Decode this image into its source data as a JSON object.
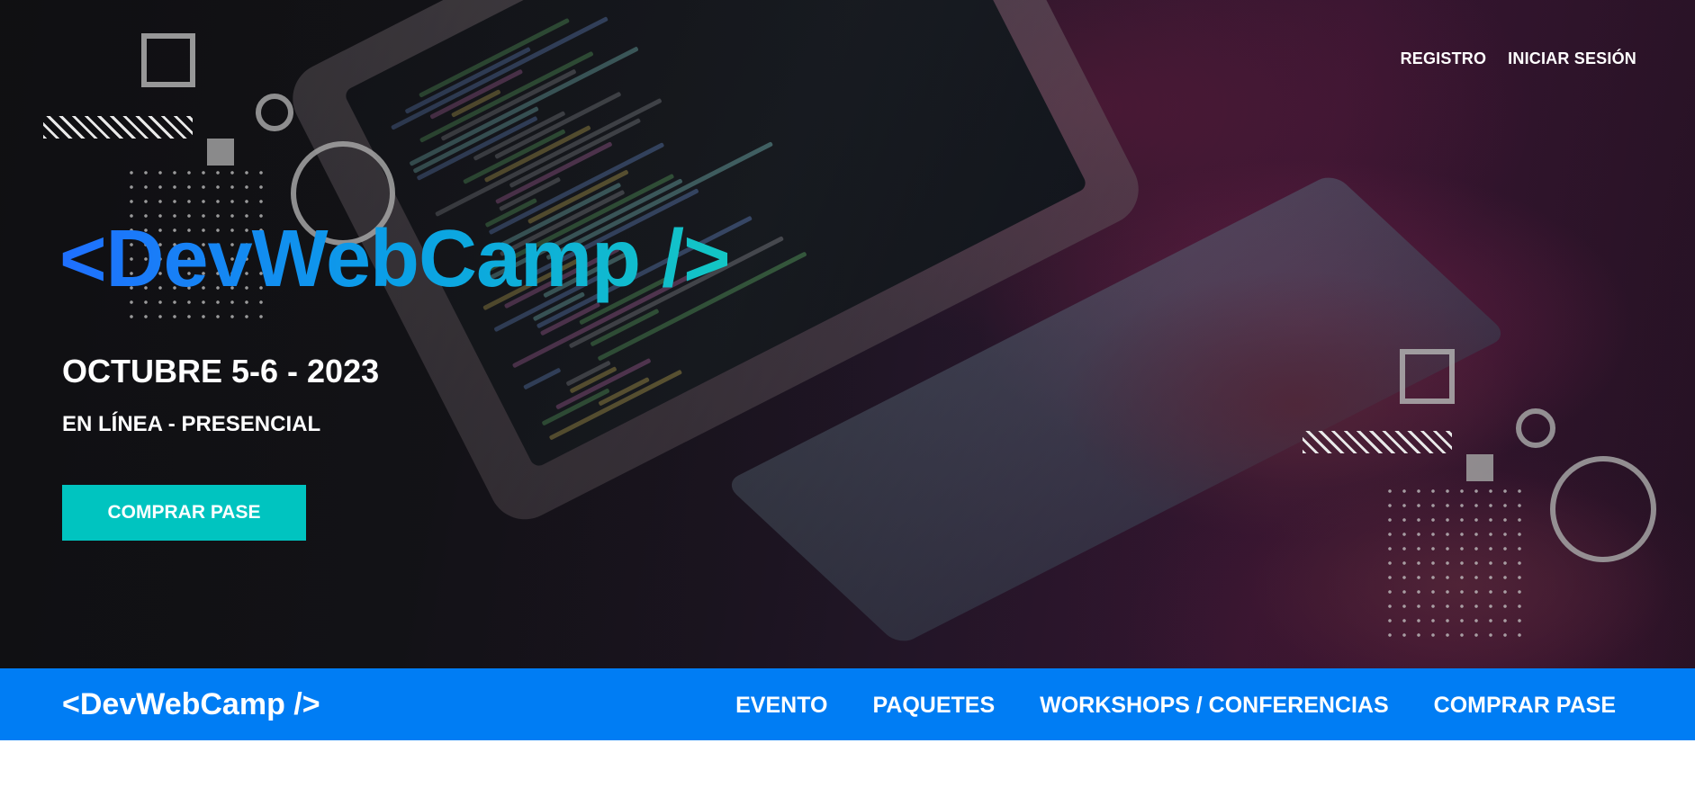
{
  "header": {
    "nav": [
      {
        "label": "REGISTRO"
      },
      {
        "label": "INICIAR SESIÓN"
      }
    ],
    "brand": "<DevWebCamp />",
    "date": "OCTUBRE 5-6 - 2023",
    "modality": "EN LÍNEA - PRESENCIAL",
    "cta_label": "COMPRAR PASE"
  },
  "navbar": {
    "logo": "<DevWebCamp />",
    "links": [
      {
        "label": "EVENTO"
      },
      {
        "label": "PAQUETES"
      },
      {
        "label": "WORKSHOPS / CONFERENCIAS"
      },
      {
        "label": "COMPRAR PASE"
      }
    ]
  },
  "colors": {
    "brand_blue": "#007df4",
    "accent_teal": "#00c4c0",
    "brand_gradient_start": "#1f6fff",
    "brand_gradient_end": "#13c7c4"
  }
}
